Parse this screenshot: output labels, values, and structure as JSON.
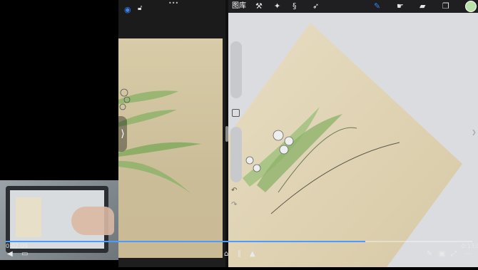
{
  "video": {
    "time_current": "0:02:09",
    "time_total": "0:13:00",
    "progress": 0.77
  },
  "procreate": {
    "gallery_label": "图库",
    "icons": [
      "wrench-icon",
      "magic-wand-icon",
      "selection-icon",
      "transform-arrow-icon",
      "brush-icon",
      "smudge-icon",
      "eraser-icon",
      "layers-icon",
      "color-swatch"
    ],
    "active_color": "#b9e3a9"
  },
  "reference": {
    "icons": [
      "eye-icon",
      "unlock-icon",
      "more-dots-icon"
    ]
  },
  "glyphs": {
    "left_chevron": "❮",
    "right_chevron": "❯",
    "more_dots": "•••",
    "undo": "↶",
    "redo": "↷",
    "panel_handle": "⟩"
  }
}
